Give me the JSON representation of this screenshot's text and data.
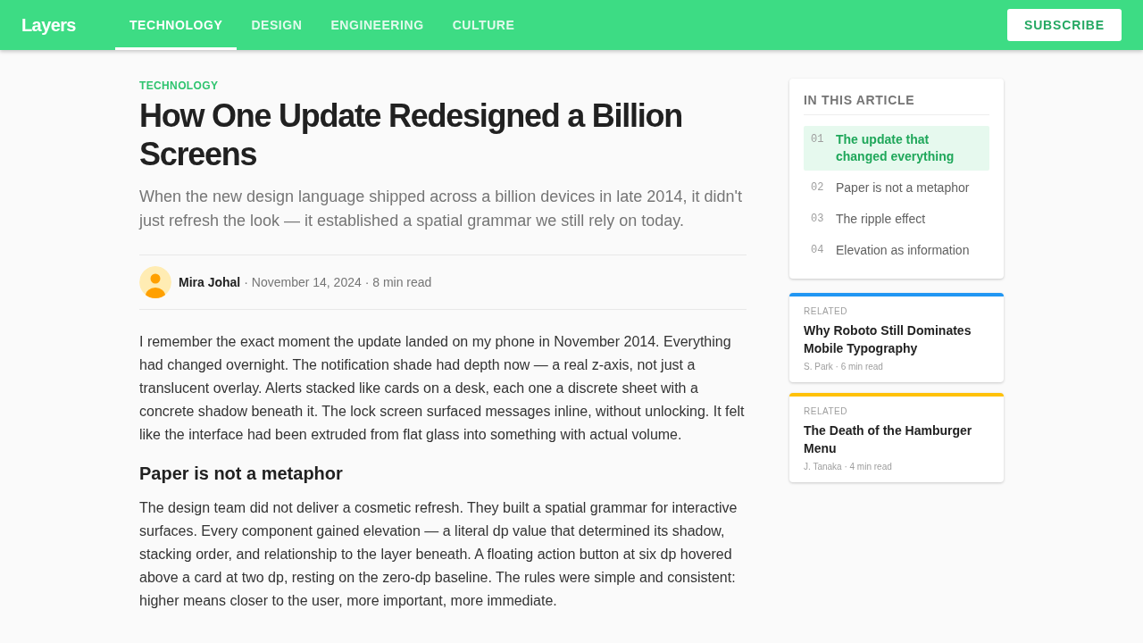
{
  "header": {
    "logo": "Layers",
    "nav": [
      {
        "label": "TECHNOLOGY",
        "selected": true
      },
      {
        "label": "DESIGN",
        "selected": false
      },
      {
        "label": "ENGINEERING",
        "selected": false
      },
      {
        "label": "CULTURE",
        "selected": false
      }
    ],
    "subscribe_button": "SUBSCRIBE"
  },
  "article": {
    "category": "TECHNOLOGY",
    "title": "How One Update Redesigned a Billion Screens",
    "lede": "When the new design language shipped across a billion devices in late 2014, it didn't just refresh the look — it established a spatial grammar we still rely on today.",
    "byline": {
      "author": "Mira Johal",
      "details": "· November 14, 2024 · 8 min read"
    },
    "body": [
      {
        "kind": "paragraph",
        "text": "I remember the exact moment the update landed on my phone in November 2014. Everything had changed overnight. The notification shade had depth now — a real z-axis, not just a translucent overlay. Alerts stacked like cards on a desk, each one a discrete sheet with a concrete shadow beneath it. The lock screen surfaced messages inline, without unlocking. It felt like the interface had been extruded from flat glass into something with actual volume."
      },
      {
        "kind": "heading",
        "text": "Paper is not a metaphor"
      },
      {
        "kind": "paragraph",
        "text": "The design team did not deliver a cosmetic refresh. They built a spatial grammar for interactive surfaces. Every component gained elevation — a literal dp value that determined its shadow, stacking order, and relationship to the layer beneath. A floating action button at six dp hovered above a card at two dp, resting on the zero-dp baseline. The rules were simple and consistent: higher means closer to the user, more important, more immediate."
      }
    ]
  },
  "sidebar": {
    "toc": {
      "title": "IN THIS ARTICLE",
      "items": [
        {
          "number": "01",
          "label": "The update that changed everything",
          "selected": true
        },
        {
          "number": "02",
          "label": "Paper is not a metaphor",
          "selected": false
        },
        {
          "number": "03",
          "label": "The ripple effect",
          "selected": false
        },
        {
          "number": "04",
          "label": "Elevation as information",
          "selected": false
        }
      ]
    },
    "related": [
      {
        "label": "RELATED",
        "title": "Why Roboto Still Dominates Mobile Typography",
        "meta": "S. Park · 6 min read",
        "color": "#2196f3"
      },
      {
        "label": "RELATED",
        "title": "The Death of the Hamburger Menu",
        "meta": "J. Tanaka · 4 min read",
        "color": "#ffc107"
      }
    ]
  }
}
